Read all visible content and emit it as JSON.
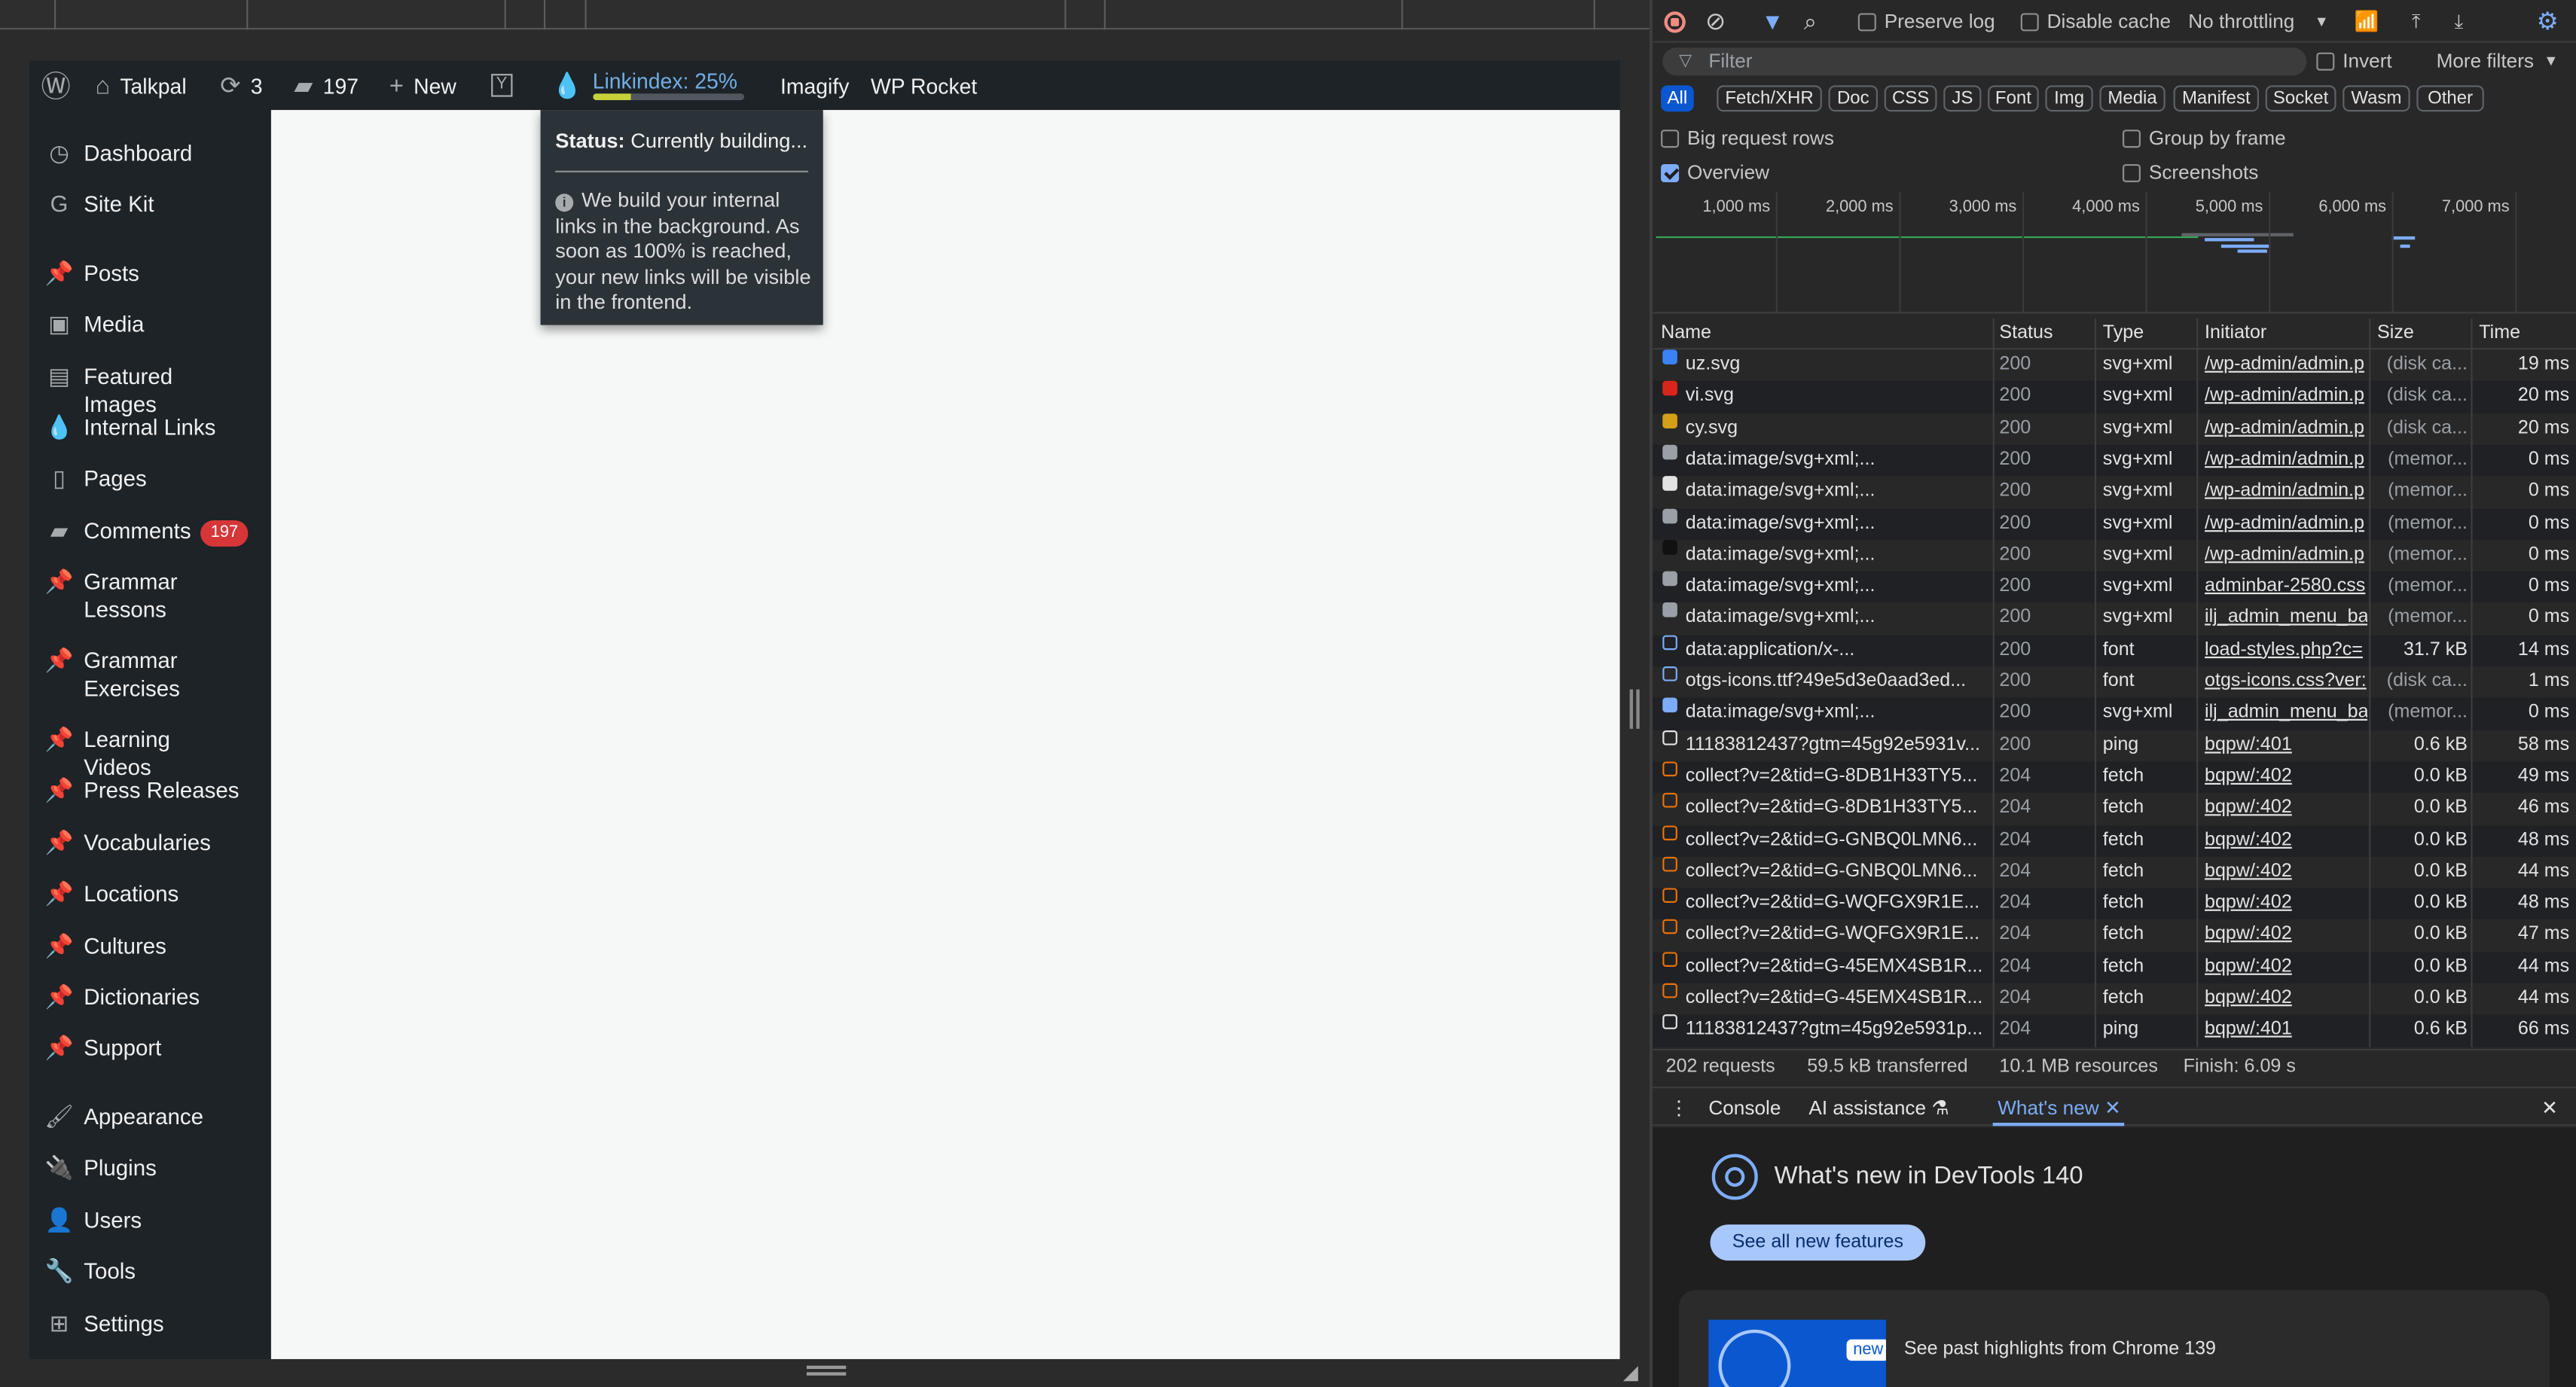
{
  "wordpress": {
    "site_name": "Talkpal",
    "updates_count": "3",
    "comments_count": "197",
    "new_label": "New",
    "linkindex_label": "Linkindex: 25%",
    "linkindex_progress_percent": 25,
    "imagify_label": "Imagify",
    "wprocket_label": "WP Rocket",
    "tooltip": {
      "status_label": "Status:",
      "status_value": "Currently building...",
      "description": "We build your internal links in the background. As soon as 100% is reached, your new links will be visible in the frontend."
    },
    "menu": [
      {
        "label": "Dashboard",
        "icon": "dashboard-icon",
        "glyph": "◷"
      },
      {
        "label": "Site Kit",
        "icon": "google-g-icon",
        "glyph": "G"
      },
      {
        "label": "Posts",
        "icon": "pin-icon",
        "glyph": "📌"
      },
      {
        "label": "Media",
        "icon": "media-icon",
        "glyph": "▣"
      },
      {
        "label": "Featured Images",
        "icon": "images-icon",
        "glyph": "▤"
      },
      {
        "label": "Internal Links",
        "icon": "drop-icon",
        "glyph": "💧"
      },
      {
        "label": "Pages",
        "icon": "pages-icon",
        "glyph": "▯"
      },
      {
        "label": "Comments",
        "icon": "comment-icon",
        "glyph": "▰",
        "badge": "197"
      },
      {
        "label": "Grammar Lessons",
        "icon": "pin-icon",
        "glyph": "📌"
      },
      {
        "label": "Grammar Exercises",
        "icon": "pin-icon",
        "glyph": "📌"
      },
      {
        "label": "Learning Videos",
        "icon": "pin-icon",
        "glyph": "📌"
      },
      {
        "label": "Press Releases",
        "icon": "pin-icon",
        "glyph": "📌"
      },
      {
        "label": "Vocabularies",
        "icon": "pin-icon",
        "glyph": "📌"
      },
      {
        "label": "Locations",
        "icon": "pin-icon",
        "glyph": "📌"
      },
      {
        "label": "Cultures",
        "icon": "pin-icon",
        "glyph": "📌"
      },
      {
        "label": "Dictionaries",
        "icon": "pin-icon",
        "glyph": "📌"
      },
      {
        "label": "Support",
        "icon": "pin-icon",
        "glyph": "📌"
      },
      {
        "label": "Appearance",
        "icon": "brush-icon",
        "glyph": "🖌"
      },
      {
        "label": "Plugins",
        "icon": "plugin-icon",
        "glyph": "🔌"
      },
      {
        "label": "Users",
        "icon": "user-icon",
        "glyph": "👤"
      },
      {
        "label": "Tools",
        "icon": "wrench-icon",
        "glyph": "🔧"
      },
      {
        "label": "Settings",
        "icon": "settings-icon",
        "glyph": "⊞"
      }
    ]
  },
  "devtools": {
    "toolbar": {
      "preserve_log": "Preserve log",
      "disable_cache": "Disable cache",
      "throttling": "No throttling"
    },
    "filter": {
      "placeholder": "Filter",
      "invert": "Invert",
      "more_filters": "More filters"
    },
    "types": [
      "All",
      "Fetch/XHR",
      "Doc",
      "CSS",
      "JS",
      "Font",
      "Img",
      "Media",
      "Manifest",
      "Socket",
      "Wasm",
      "Other"
    ],
    "options": {
      "big_rows": "Big request rows",
      "group_by_frame": "Group by frame",
      "overview": "Overview",
      "screenshots": "Screenshots"
    },
    "timeline_ticks": [
      "1,000 ms",
      "2,000 ms",
      "3,000 ms",
      "4,000 ms",
      "5,000 ms",
      "6,000 ms",
      "7,000 ms"
    ],
    "columns": {
      "name": "Name",
      "status": "Status",
      "type": "Type",
      "initiator": "Initiator",
      "size": "Size",
      "time": "Time"
    },
    "rows": [
      {
        "name": "uz.svg",
        "status": "200",
        "type": "svg+xml",
        "initiator": "/wp-admin/admin.p",
        "size": "(disk ca...",
        "time": "19 ms",
        "icon": "flag-icon",
        "color": "#3b82f6"
      },
      {
        "name": "vi.svg",
        "status": "200",
        "type": "svg+xml",
        "initiator": "/wp-admin/admin.p",
        "size": "(disk ca...",
        "time": "20 ms",
        "icon": "flag-icon",
        "color": "#da251d"
      },
      {
        "name": "cy.svg",
        "status": "200",
        "type": "svg+xml",
        "initiator": "/wp-admin/admin.p",
        "size": "(disk ca...",
        "time": "20 ms",
        "icon": "flag-icon",
        "color": "#d4a017"
      },
      {
        "name": "data:image/svg+xml;...",
        "status": "200",
        "type": "svg+xml",
        "initiator": "/wp-admin/admin.p",
        "size": "(memor...",
        "time": "0 ms",
        "icon": "google-g-icon",
        "color": "#9aa0a6"
      },
      {
        "name": "data:image/svg+xml;...",
        "status": "200",
        "type": "svg+xml",
        "initiator": "/wp-admin/admin.p",
        "size": "(memor...",
        "time": "0 ms",
        "icon": "drop-icon",
        "color": "#e3e3e3"
      },
      {
        "name": "data:image/svg+xml;...",
        "status": "200",
        "type": "svg+xml",
        "initiator": "/wp-admin/admin.p",
        "size": "(memor...",
        "time": "0 ms",
        "icon": "yoast-icon",
        "color": "#9aa0a6"
      },
      {
        "name": "data:image/svg+xml;...",
        "status": "200",
        "type": "svg+xml",
        "initiator": "/wp-admin/admin.p",
        "size": "(memor...",
        "time": "0 ms",
        "icon": "dot-icon",
        "color": "#111111"
      },
      {
        "name": "data:image/svg+xml;...",
        "status": "200",
        "type": "svg+xml",
        "initiator": "adminbar-2580.css",
        "size": "(memor...",
        "time": "0 ms",
        "icon": "yoast-icon",
        "color": "#9aa0a6"
      },
      {
        "name": "data:image/svg+xml;...",
        "status": "200",
        "type": "svg+xml",
        "initiator": "ilj_admin_menu_ba",
        "size": "(memor...",
        "time": "0 ms",
        "icon": "drop-icon",
        "color": "#9aa0a6"
      },
      {
        "name": "data:application/x-...",
        "status": "200",
        "type": "font",
        "initiator": "load-styles.php?c=",
        "size": "31.7 kB",
        "time": "14 ms",
        "icon": "font-icon",
        "color": "#7cacf8"
      },
      {
        "name": "otgs-icons.ttf?49e5d3e0aad3ed...",
        "status": "200",
        "type": "font",
        "initiator": "otgs-icons.css?ver:",
        "size": "(disk ca...",
        "time": "1 ms",
        "icon": "font-icon",
        "color": "#7cacf8"
      },
      {
        "name": "data:image/svg+xml;...",
        "status": "200",
        "type": "svg+xml",
        "initiator": "ilj_admin_menu_ba",
        "size": "(memor...",
        "time": "0 ms",
        "icon": "drop-icon",
        "color": "#7cacf8"
      },
      {
        "name": "11183812437?gtm=45g92e5931v...",
        "status": "200",
        "type": "ping",
        "initiator": "bqpw/:401",
        "size": "0.6 kB",
        "time": "58 ms",
        "icon": "document-icon",
        "color": "#e3e3e3"
      },
      {
        "name": "collect?v=2&tid=G-8DB1H33TY5...",
        "status": "204",
        "type": "fetch",
        "initiator": "bqpw/:402",
        "size": "0.0 kB",
        "time": "49 ms",
        "icon": "fetch-icon",
        "color": "#e8710a"
      },
      {
        "name": "collect?v=2&tid=G-8DB1H33TY5...",
        "status": "204",
        "type": "fetch",
        "initiator": "bqpw/:402",
        "size": "0.0 kB",
        "time": "46 ms",
        "icon": "fetch-icon",
        "color": "#e8710a"
      },
      {
        "name": "collect?v=2&tid=G-GNBQ0LMN6...",
        "status": "204",
        "type": "fetch",
        "initiator": "bqpw/:402",
        "size": "0.0 kB",
        "time": "48 ms",
        "icon": "fetch-icon",
        "color": "#e8710a"
      },
      {
        "name": "collect?v=2&tid=G-GNBQ0LMN6...",
        "status": "204",
        "type": "fetch",
        "initiator": "bqpw/:402",
        "size": "0.0 kB",
        "time": "44 ms",
        "icon": "fetch-icon",
        "color": "#e8710a"
      },
      {
        "name": "collect?v=2&tid=G-WQFGX9R1E...",
        "status": "204",
        "type": "fetch",
        "initiator": "bqpw/:402",
        "size": "0.0 kB",
        "time": "48 ms",
        "icon": "fetch-icon",
        "color": "#e8710a"
      },
      {
        "name": "collect?v=2&tid=G-WQFGX9R1E...",
        "status": "204",
        "type": "fetch",
        "initiator": "bqpw/:402",
        "size": "0.0 kB",
        "time": "47 ms",
        "icon": "fetch-icon",
        "color": "#e8710a"
      },
      {
        "name": "collect?v=2&tid=G-45EMX4SB1R...",
        "status": "204",
        "type": "fetch",
        "initiator": "bqpw/:402",
        "size": "0.0 kB",
        "time": "44 ms",
        "icon": "fetch-icon",
        "color": "#e8710a"
      },
      {
        "name": "collect?v=2&tid=G-45EMX4SB1R...",
        "status": "204",
        "type": "fetch",
        "initiator": "bqpw/:402",
        "size": "0.0 kB",
        "time": "44 ms",
        "icon": "fetch-icon",
        "color": "#e8710a"
      },
      {
        "name": "11183812437?gtm=45g92e5931p...",
        "status": "204",
        "type": "ping",
        "initiator": "bqpw/:401",
        "size": "0.6 kB",
        "time": "66 ms",
        "icon": "document-icon",
        "color": "#e3e3e3"
      }
    ],
    "summary": {
      "requests": "202 requests",
      "transferred": "59.5 kB transferred",
      "resources": "10.1 MB resources",
      "finish": "Finish: 6.09 s"
    },
    "drawer_tabs": {
      "console": "Console",
      "ai": "AI assistance",
      "whats_new": "What's new"
    },
    "whats_new": {
      "title": "What's new in DevTools 140",
      "button": "See all new features",
      "new_badge": "new",
      "highlight": "See past highlights from Chrome 139"
    }
  }
}
